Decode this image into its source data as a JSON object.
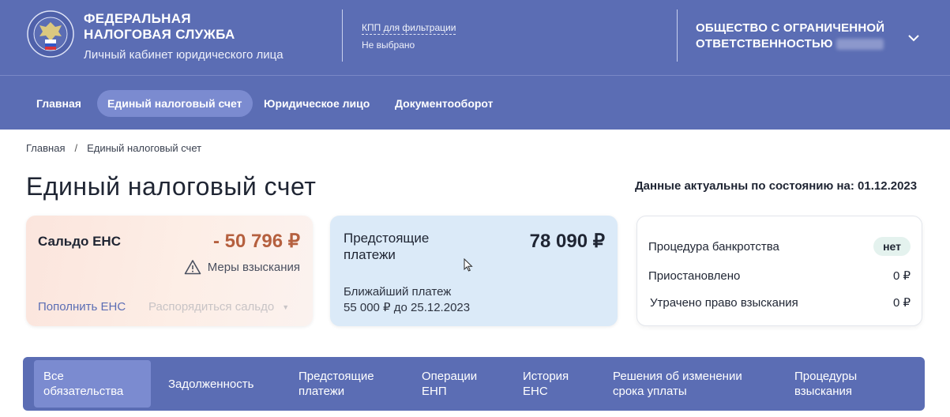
{
  "header": {
    "org_line1": "ФЕДЕРАЛЬНАЯ",
    "org_line2": "НАЛОГОВАЯ СЛУЖБА",
    "org_sub": "Личный кабинет юридического лица",
    "kpp_label": "КПП для фильтрации",
    "kpp_value": "Не выбрано",
    "company_line1": "ОБЩЕСТВО С ОГРАНИЧЕННОЙ",
    "company_line2": "ОТВЕТСТВЕННОСТЬЮ",
    "logo_icon": "fns-emblem-icon",
    "dropdown_icon": "chevron-down-icon"
  },
  "nav": {
    "items": [
      {
        "label": "Главная"
      },
      {
        "label": "Единый налоговый счет",
        "active": true
      },
      {
        "label": "Юридическое лицо"
      },
      {
        "label": "Документооборот"
      }
    ]
  },
  "breadcrumb": {
    "home": "Главная",
    "separator": "/",
    "current": "Единый налоговый счет"
  },
  "page": {
    "title": "Единый налоговый счет",
    "actual_date": "Данные актуальны по состоянию на: 01.12.2023"
  },
  "saldo": {
    "label": "Сальдо ЕНС",
    "value": "- 50 796 ₽",
    "measures": "Меры взыскания",
    "topup": "Пополнить ЕНС",
    "dispose": "Распорядиться сальдо"
  },
  "upcoming": {
    "label": "Предстоящие платежи",
    "value": "78 090 ₽",
    "nearest_label": "Ближайший платеж",
    "nearest_value": "55 000 ₽ до 25.12.2023"
  },
  "status": {
    "rows": [
      {
        "label": "Процедура банкротства",
        "value": "нет"
      },
      {
        "label": "Приостановлено",
        "value": "0 ₽"
      },
      {
        "label": "Утрачено право взыскания",
        "value": "0 ₽"
      }
    ]
  },
  "tabs": {
    "items": [
      {
        "line1": "Все",
        "line2": "обязательства",
        "active": true
      },
      {
        "line1": "Задолженность",
        "line2": ""
      },
      {
        "line1": "Предстоящие",
        "line2": "платежи"
      },
      {
        "line1": "Операции",
        "line2": "ЕНП"
      },
      {
        "line1": "История",
        "line2": "ЕНС"
      },
      {
        "line1": "Решения об изменении",
        "line2": "срока уплаты"
      },
      {
        "line1": "Процедуры",
        "line2": "взыскания"
      }
    ]
  },
  "colors": {
    "brand": "#5b6db4",
    "active_pill": "#7b8bd0",
    "negative": "#b5603f",
    "upcoming_bg": "#dbeaf8"
  }
}
